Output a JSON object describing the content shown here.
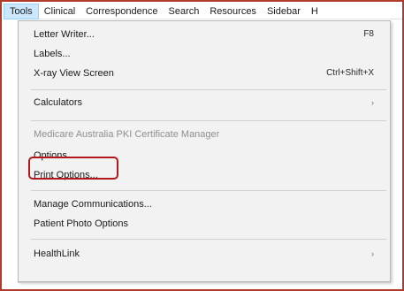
{
  "menubar": {
    "items": [
      "Tools",
      "Clinical",
      "Correspondence",
      "Search",
      "Resources",
      "Sidebar",
      "H"
    ]
  },
  "tools_menu": {
    "items": [
      {
        "label": "Letter Writer...",
        "shortcut": "F8"
      },
      {
        "label": "Labels..."
      },
      {
        "label": "X-ray View Screen",
        "shortcut": "Ctrl+Shift+X"
      },
      {
        "label": "Calculators",
        "submenu": "›"
      },
      {
        "label": "Medicare Australia PKI Certificate Manager",
        "disabled": true
      },
      {
        "label": "Options..."
      },
      {
        "label": "Print Options..."
      },
      {
        "label": "Manage Communications..."
      },
      {
        "label": "Patient Photo Options"
      },
      {
        "label": "HealthLink",
        "submenu": "›"
      }
    ]
  },
  "colors": {
    "frame_border": "#b03b2a",
    "highlight_border": "#b0181b",
    "menu_background": "#f2f2f2",
    "active_menubar": "#cce8ff",
    "disabled_text": "#8f8f8f"
  }
}
